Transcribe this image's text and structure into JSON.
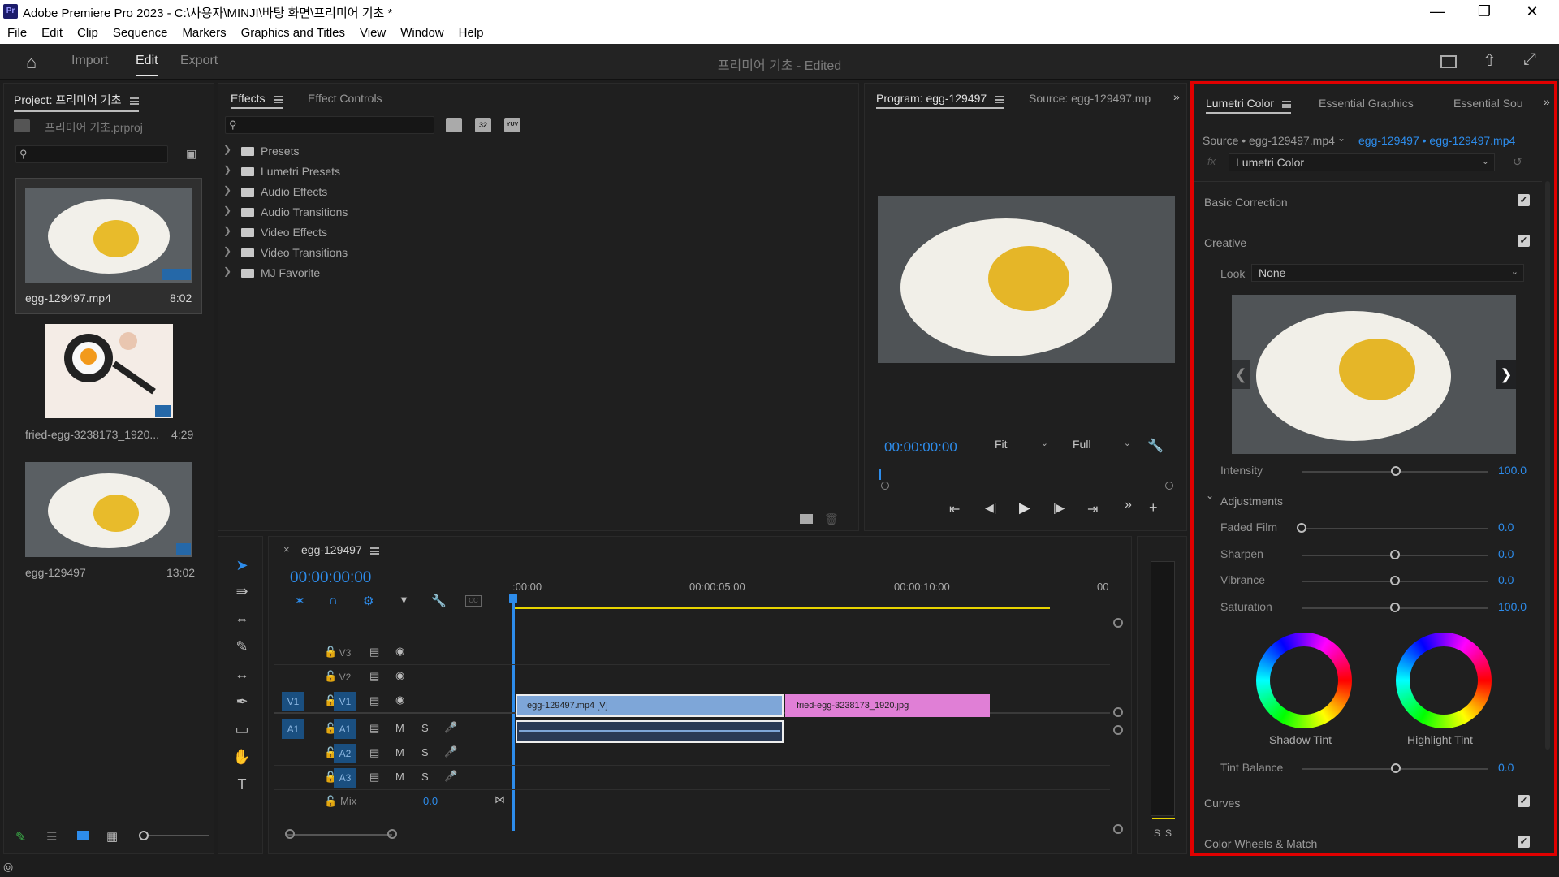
{
  "window": {
    "title": "Adobe Premiere Pro 2023 - C:\\사용자\\MINJI\\바탕 화면\\프리미어 기초 *",
    "app_badge": "Pr"
  },
  "menu": [
    "File",
    "Edit",
    "Clip",
    "Sequence",
    "Markers",
    "Graphics and Titles",
    "View",
    "Window",
    "Help"
  ],
  "workspace": {
    "tabs": [
      "Import",
      "Edit",
      "Export"
    ],
    "active": "Edit",
    "doc_title": "프리미어 기초 - Edited"
  },
  "project": {
    "title": "Project: 프리미어 기초",
    "file": "프리미어 기초.prproj",
    "items": [
      {
        "name": "egg-129497.mp4",
        "duration": "8:02"
      },
      {
        "name": "fried-egg-3238173_1920...",
        "duration": "4;29"
      },
      {
        "name": "egg-129497",
        "duration": "13:02"
      }
    ]
  },
  "effects": {
    "tabs": [
      "Effects",
      "Effect Controls"
    ],
    "active": "Effects",
    "icons": [
      "32",
      "YUV"
    ],
    "tree": [
      "Presets",
      "Lumetri Presets",
      "Audio Effects",
      "Audio Transitions",
      "Video Effects",
      "Video Transitions",
      "MJ Favorite"
    ]
  },
  "program": {
    "tabs": [
      "Program: egg-129497",
      "Source: egg-129497.mp"
    ],
    "timecode": "00:00:00:00",
    "fit": "Fit",
    "quality": "Full"
  },
  "timeline": {
    "tab": "egg-129497",
    "timecode": "00:00:00:00",
    "ruler": [
      ":00:00",
      "00:00:05:00",
      "00:00:10:00",
      "00"
    ],
    "tracks": {
      "v3": "V3",
      "v2": "V2",
      "v1": "V1",
      "a1": "A1",
      "a2": "A2",
      "a3": "A3",
      "v1_src": "V1",
      "a1_src": "A1"
    },
    "m": "M",
    "s": "S",
    "mix_label": "Mix",
    "mix_value": "0.0",
    "clips": [
      {
        "label": "egg-129497.mp4 [V]"
      },
      {
        "label": "fried-egg-3238173_1920.jpg"
      }
    ],
    "audio_meter_labels": [
      "S",
      "S"
    ]
  },
  "lumetri": {
    "tabs": [
      "Lumetri Color",
      "Essential Graphics",
      "Essential Sou"
    ],
    "active": "Lumetri Color",
    "source": "Source • egg-129497.mp4",
    "target": "egg-129497 • egg-129497.mp4",
    "effect": "Lumetri Color",
    "sections": [
      "Basic Correction",
      "Creative",
      "Curves",
      "Color Wheels & Match"
    ],
    "look_label": "Look",
    "look_value": "None",
    "intensity_label": "Intensity",
    "intensity": "100.0",
    "adjustments_label": "Adjustments",
    "adjustments": [
      {
        "label": "Faded Film",
        "value": "0.0",
        "level": 0.0
      },
      {
        "label": "Sharpen",
        "value": "0.0",
        "level": 0.5
      },
      {
        "label": "Vibrance",
        "value": "0.0",
        "level": 0.5
      },
      {
        "label": "Saturation",
        "value": "100.0",
        "level": 0.5
      }
    ],
    "wheels": [
      "Shadow Tint",
      "Highlight Tint"
    ],
    "tint_balance_label": "Tint Balance",
    "tint_balance": "0.0"
  },
  "colors": {
    "accent_blue": "#2d8ceb",
    "highlight_box": "#e00000",
    "clip_video": "#7ea6d8",
    "clip_image": "#e07fd6",
    "work_area": "#e8d400"
  }
}
